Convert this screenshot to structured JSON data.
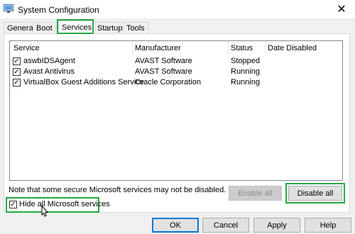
{
  "window": {
    "title": "System Configuration",
    "close_glyph": "✕"
  },
  "tabs": [
    {
      "label": "General",
      "active": false
    },
    {
      "label": "Boot",
      "active": false
    },
    {
      "label": "Services",
      "active": true
    },
    {
      "label": "Startup",
      "active": false
    },
    {
      "label": "Tools",
      "active": false
    }
  ],
  "services_table": {
    "columns": [
      "Service",
      "Manufacturer",
      "Status",
      "Date Disabled"
    ],
    "rows": [
      {
        "checked": true,
        "service": "aswbIDSAgent",
        "manufacturer": "AVAST Software",
        "status": "Stopped",
        "date_disabled": ""
      },
      {
        "checked": true,
        "service": "Avast Antivirus",
        "manufacturer": "AVAST Software",
        "status": "Running",
        "date_disabled": ""
      },
      {
        "checked": true,
        "service": "VirtualBox Guest Additions Service",
        "manufacturer": "Oracle Corporation",
        "status": "Running",
        "date_disabled": ""
      }
    ]
  },
  "note": "Note that some secure Microsoft services may not be disabled.",
  "buttons": {
    "enable_all": "Enable all",
    "disable_all": "Disable all",
    "ok": "OK",
    "cancel": "Cancel",
    "apply": "Apply",
    "help": "Help"
  },
  "hide_microsoft": {
    "label": "Hide all Microsoft services",
    "checked": true
  },
  "colors": {
    "highlight": "#26a843",
    "accent": "#0078d7"
  }
}
